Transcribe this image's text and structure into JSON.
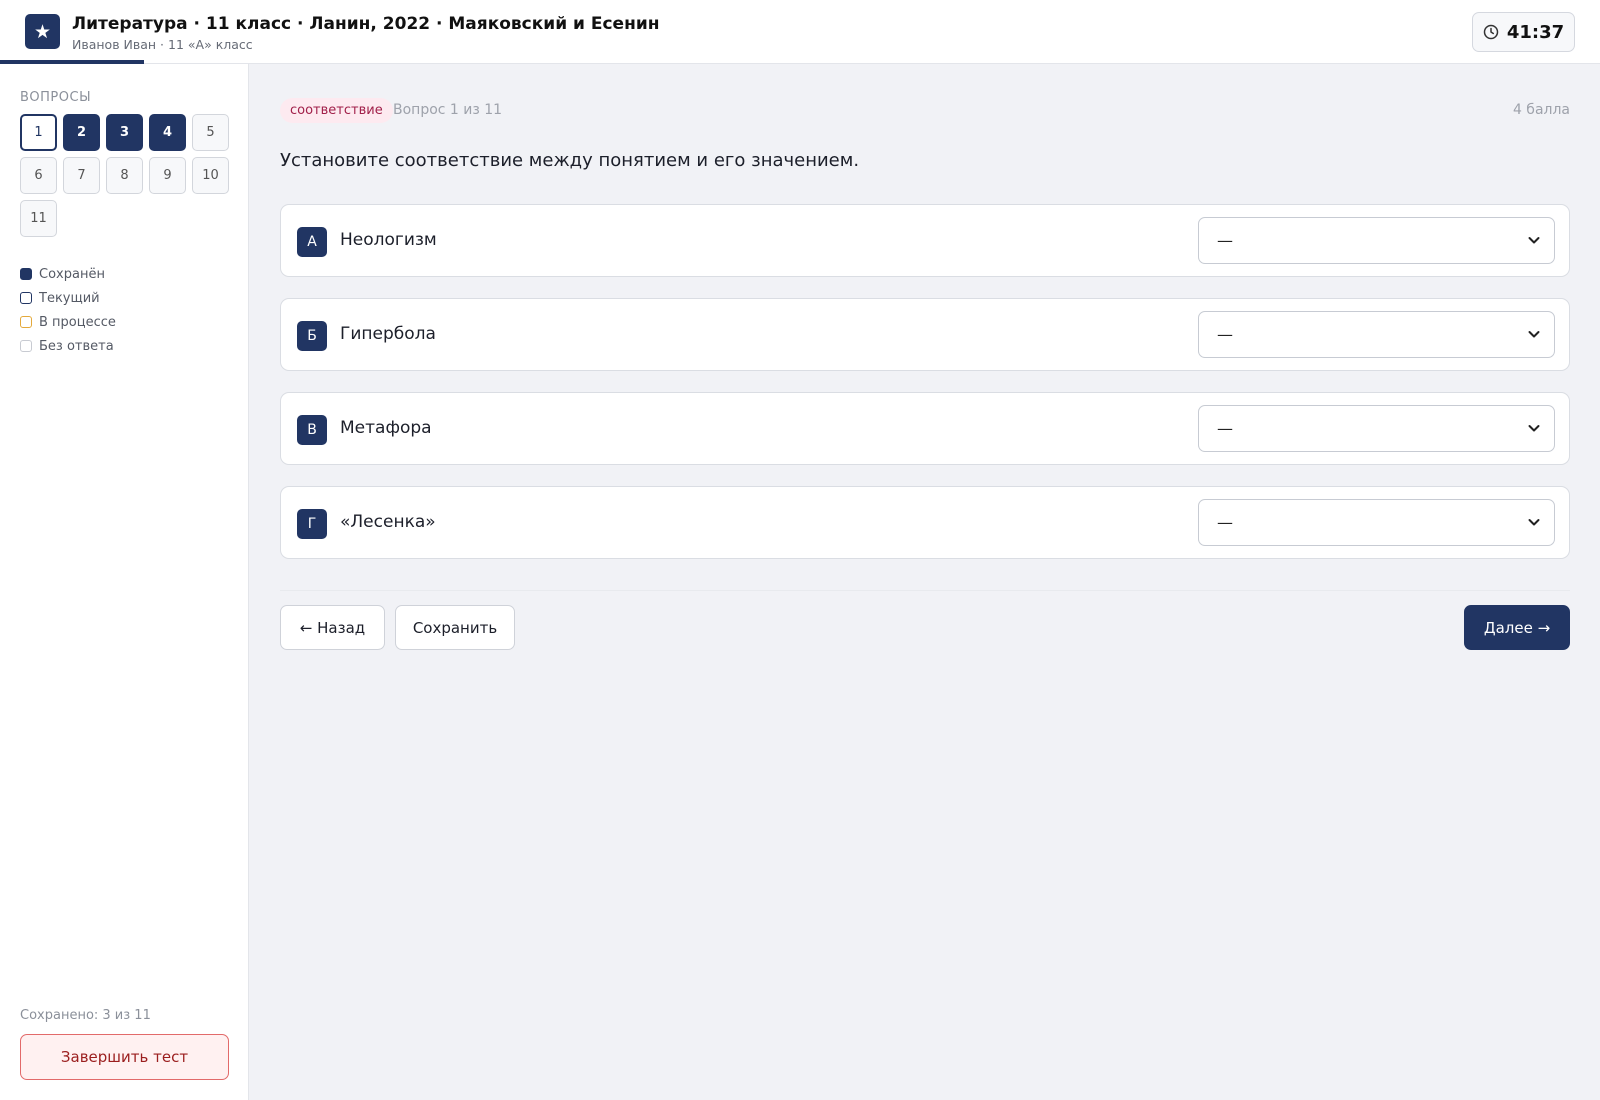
{
  "header": {
    "logo_icon": "★",
    "title": "Литература · 11 класс · Ланин, 2022 · Маяковский и Есенин",
    "subtitle": "Иванов Иван · 11 «А» класс",
    "timer": "41:37",
    "progress_fraction": 0.09
  },
  "sidebar": {
    "heading": "ВОПРОСЫ",
    "questions": [
      {
        "label": "1",
        "state": "current"
      },
      {
        "label": "2",
        "state": "saved"
      },
      {
        "label": "3",
        "state": "saved"
      },
      {
        "label": "4",
        "state": "saved"
      },
      {
        "label": "5",
        "state": "empty"
      },
      {
        "label": "6",
        "state": "empty"
      },
      {
        "label": "7",
        "state": "empty"
      },
      {
        "label": "8",
        "state": "empty"
      },
      {
        "label": "9",
        "state": "empty"
      },
      {
        "label": "10",
        "state": "empty"
      },
      {
        "label": "11",
        "state": "empty"
      }
    ],
    "legend": [
      {
        "label": "Сохранён",
        "type": "saved"
      },
      {
        "label": "Текущий",
        "type": "current"
      },
      {
        "label": "В процессе",
        "type": "progress"
      },
      {
        "label": "Без ответа",
        "type": "empty"
      }
    ],
    "saved_count": "Сохранено: 3 из 11",
    "finish_label": "Завершить тест"
  },
  "main": {
    "type_badge": "соответствие",
    "question_number": "Вопрос 1 из 11",
    "points": "4 балла",
    "question_text": "Установите соответствие между понятием и его значением.",
    "rows": [
      {
        "letter": "А",
        "term": "Неологизм",
        "selected": "—"
      },
      {
        "letter": "Б",
        "term": "Гипербола",
        "selected": "—"
      },
      {
        "letter": "В",
        "term": "Метафора",
        "selected": "—"
      },
      {
        "letter": "Г",
        "term": "«Лесенка»",
        "selected": "—"
      }
    ],
    "back_label": "← Назад",
    "save_label": "Сохранить",
    "next_label": "Далее →"
  },
  "colors": {
    "accent": "#213563",
    "badge_bg": "#fdeaf0",
    "badge_text": "#a1204a",
    "danger": "#e26a6a",
    "in_progress": "#e4a93b"
  }
}
